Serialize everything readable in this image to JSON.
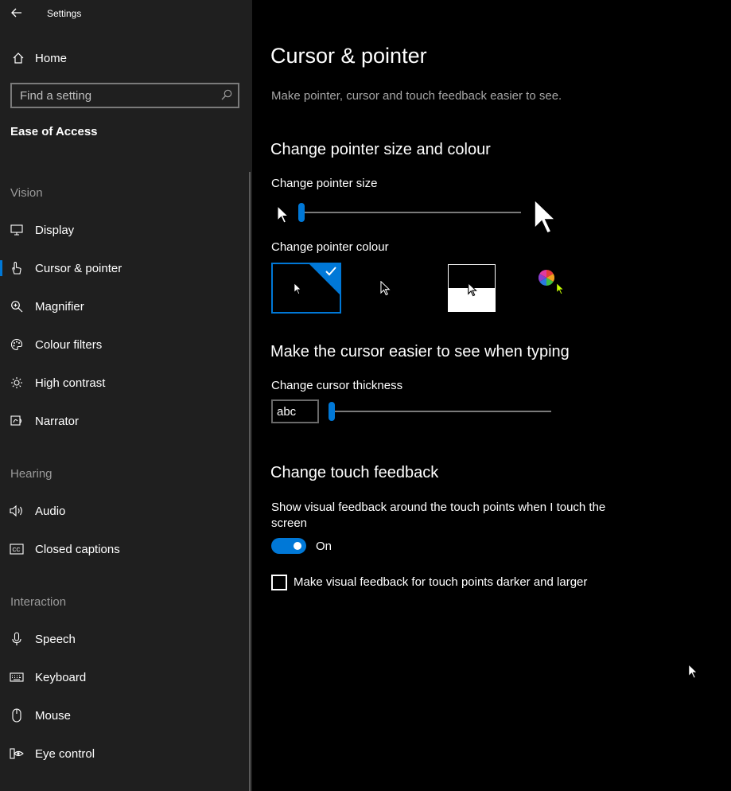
{
  "app": {
    "title": "Settings"
  },
  "sidebar": {
    "home_label": "Home",
    "search_placeholder": "Find a setting",
    "category": "Ease of Access",
    "sections": {
      "vision": "Vision",
      "hearing": "Hearing",
      "interaction": "Interaction"
    },
    "items": [
      {
        "label": "Display",
        "icon": "monitor-icon"
      },
      {
        "label": "Cursor & pointer",
        "icon": "pointer-hand-icon",
        "selected": true
      },
      {
        "label": "Magnifier",
        "icon": "magnifier-icon"
      },
      {
        "label": "Colour filters",
        "icon": "palette-icon"
      },
      {
        "label": "High contrast",
        "icon": "brightness-icon"
      },
      {
        "label": "Narrator",
        "icon": "narrator-icon"
      },
      {
        "label": "Audio",
        "icon": "speaker-icon"
      },
      {
        "label": "Closed captions",
        "icon": "cc-icon"
      },
      {
        "label": "Speech",
        "icon": "microphone-icon"
      },
      {
        "label": "Keyboard",
        "icon": "keyboard-icon"
      },
      {
        "label": "Mouse",
        "icon": "mouse-icon"
      },
      {
        "label": "Eye control",
        "icon": "eye-icon"
      }
    ]
  },
  "main": {
    "title": "Cursor & pointer",
    "description": "Make pointer, cursor and touch feedback easier to see.",
    "pointer_section": {
      "heading": "Change pointer size and colour",
      "size_label": "Change pointer size",
      "size_value": 1,
      "colour_label": "Change pointer colour",
      "colour_options": [
        "white",
        "black",
        "inverted",
        "custom"
      ],
      "selected_colour": "white"
    },
    "cursor_section": {
      "heading": "Make the cursor easier to see when typing",
      "thickness_label": "Change cursor thickness",
      "preview_text": "abc",
      "thickness_value": 1
    },
    "touch_section": {
      "heading": "Change touch feedback",
      "description": "Show visual feedback around the touch points when I touch the screen",
      "toggle_state": "On",
      "checkbox_label": "Make visual feedback for touch points darker and larger",
      "checkbox_checked": false
    }
  },
  "colors": {
    "accent": "#0078d7",
    "sidebar_bg": "#1f1f1f",
    "main_bg": "#000000"
  }
}
